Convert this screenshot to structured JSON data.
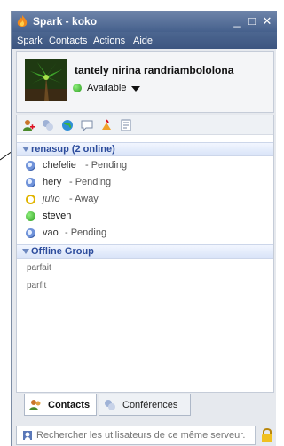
{
  "window": {
    "title": "Spark - koko",
    "controls": {
      "minimize": "_",
      "maximize": "□",
      "close": "✕"
    }
  },
  "menu": {
    "items": [
      "Spark",
      "Contacts",
      "Actions",
      "Aide"
    ]
  },
  "profile": {
    "name": "tantely nirina randriambololona",
    "status": "Available"
  },
  "toolbar": {
    "icons": [
      "add-contact-icon",
      "presence-icon",
      "globe-icon",
      "chat-icon",
      "broadcast-icon",
      "notes-icon"
    ]
  },
  "groups": [
    {
      "label": "renasup (2 online)",
      "contacts": [
        {
          "name": "chefelie",
          "status": "- Pending",
          "state": "pending"
        },
        {
          "name": "hery",
          "status": "- Pending",
          "state": "pending"
        },
        {
          "name": "julio",
          "status": "- Away",
          "state": "away"
        },
        {
          "name": "steven",
          "status": "",
          "state": "online"
        },
        {
          "name": "vao",
          "status": "- Pending",
          "state": "pending"
        }
      ]
    },
    {
      "label": "Offline Group",
      "contacts": [
        {
          "name": "parfait"
        },
        {
          "name": "parfit"
        }
      ]
    }
  ],
  "tabs": [
    {
      "label": "Contacts",
      "active": true
    },
    {
      "label": "Conférences",
      "active": false
    }
  ],
  "search": {
    "placeholder": "Rechercher les utilisateurs de ce même serveur."
  },
  "colors": {
    "titlebar": "#45608c",
    "group_label": "#2c4c9c",
    "online": "#2a9a1d",
    "away": "#e0b400",
    "pending": "#3a5fab"
  }
}
